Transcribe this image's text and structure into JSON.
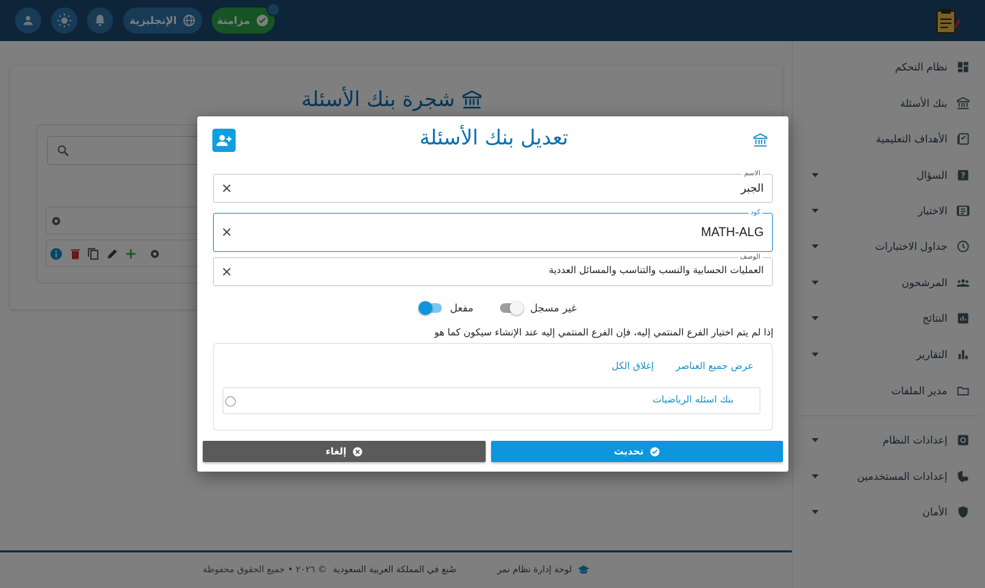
{
  "topbar": {
    "sync_label": "مزامنة",
    "language_label": "الإنجليزية",
    "icons": [
      "user-icon",
      "brightness-icon",
      "bell-icon",
      "globe-icon",
      "check-circle-icon",
      "exam-logo-icon"
    ]
  },
  "sidebar": {
    "items": [
      {
        "label": "نظام التحكم",
        "icon": "dashboard-icon",
        "expandable": false
      },
      {
        "label": "بنك الأسئلة",
        "icon": "bank-icon",
        "expandable": false
      },
      {
        "label": "الأهداف التعليمية",
        "icon": "objectives-icon",
        "expandable": false
      },
      {
        "label": "السؤال",
        "icon": "question-icon",
        "expandable": true
      },
      {
        "label": "الاختبار",
        "icon": "exam-icon",
        "expandable": true
      },
      {
        "label": "جداول الاختبارات",
        "icon": "clock-icon",
        "expandable": true
      },
      {
        "label": "المرشحون",
        "icon": "people-icon",
        "expandable": true
      },
      {
        "label": "النتائج",
        "icon": "results-icon",
        "expandable": true
      },
      {
        "label": "التقارير",
        "icon": "bar-chart-icon",
        "expandable": true
      },
      {
        "label": "مدير الملفات",
        "icon": "folder-icon",
        "expandable": false
      }
    ],
    "settings_items": [
      {
        "label": "إعدادات النظام",
        "icon": "settings-icon",
        "expandable": true
      },
      {
        "label": "إعدادات المستخدمين",
        "icon": "user-shield-icon",
        "expandable": true
      },
      {
        "label": "الأمان",
        "icon": "shield-icon",
        "expandable": true
      }
    ]
  },
  "page": {
    "title": "شجرة بنك الأسئلة"
  },
  "modal": {
    "title": "تعديل بنك الأسئلة",
    "fields": {
      "name": {
        "label": "الاسم",
        "value": "الجبر"
      },
      "code": {
        "label": "كود",
        "value": "MATH-ALG"
      },
      "description": {
        "label": "الوصف",
        "value": "العمليات الحسابية والنسب والتناسب والمسائل العددية"
      }
    },
    "toggles": {
      "unregistered": {
        "label": "غير مسجل",
        "on": false
      },
      "enabled": {
        "label": "مفعل",
        "on": true
      }
    },
    "hint": "إذا لم يتم اختيار الفرع المنتمي إليه، فإن الفرع المنتمي إليه عند الإنشاء سيكون كما هو",
    "tree": {
      "show_all": "عرض جميع العناصر",
      "collapse_all": "إغلاق الكل",
      "node_label": "بنك اسئله الرياضيات"
    },
    "buttons": {
      "update": "تحديث",
      "cancel": "إلغاء"
    }
  },
  "footer": {
    "brand": "لوحة إدارة نظام نمر",
    "made_in": "صُنع في المملكة العربية السعودية",
    "copyright": "© ٢٠٢٦ • جميع الحقوق محفوظة"
  },
  "colors": {
    "topbar": "#1c4a72",
    "accent": "#0d95dd",
    "success": "#2ea84b",
    "title": "#0a6fb0"
  }
}
